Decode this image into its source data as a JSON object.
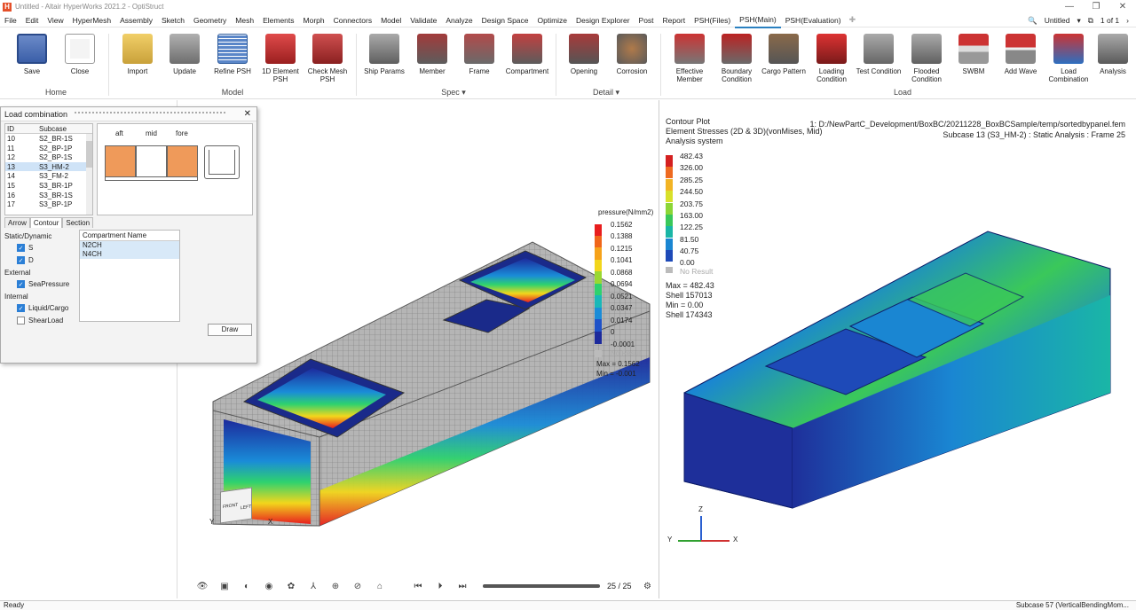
{
  "window": {
    "title": "Untitled - Altair HyperWorks 2021.2 - OptiStruct",
    "controls": [
      "—",
      "❐",
      "✕"
    ]
  },
  "menu": {
    "items": [
      "File",
      "Edit",
      "View",
      "HyperMesh",
      "Assembly",
      "Sketch",
      "Geometry",
      "Mesh",
      "Elements",
      "Morph",
      "Connectors",
      "Model",
      "Validate",
      "Analyze",
      "Design Space",
      "Optimize",
      "Design Explorer",
      "Post",
      "Report",
      "PSH(Files)",
      "PSH(Main)",
      "PSH(Evaluation)"
    ],
    "active": "PSH(Main)",
    "session": "Untitled",
    "page": "1 of 1"
  },
  "ribbon": {
    "buttons": [
      "Save",
      "Close",
      "Import",
      "Update",
      "Refine PSH",
      "1D Element PSH",
      "Check Mesh PSH",
      "Ship Params",
      "Member",
      "Frame",
      "Compartment",
      "Opening",
      "Corrosion",
      "Effective Member",
      "Boundary Condition",
      "Cargo Pattern",
      "Loading Condition",
      "Test Condition",
      "Flooded Condition",
      "SWBM",
      "Add Wave",
      "Load Combination",
      "Analysis"
    ],
    "groups": [
      "Home",
      "Model",
      "Spec",
      "Detail",
      "Load"
    ],
    "colors": {
      "icon_gray": "#8a8a8a",
      "icon_red": "#c0392b",
      "icon_green": "#3aa040",
      "icon_blue": "#3b6fc0"
    }
  },
  "load_dialog": {
    "title": "Load combination",
    "close": "✕",
    "table_headers": [
      "ID",
      "Subcase"
    ],
    "rows": [
      {
        "id": "10",
        "subcase": "S2_BR-1S"
      },
      {
        "id": "11",
        "subcase": "S2_BP-1P"
      },
      {
        "id": "12",
        "subcase": "S2_BP-1S"
      },
      {
        "id": "13",
        "subcase": "S3_HM-2"
      },
      {
        "id": "14",
        "subcase": "S3_FM-2"
      },
      {
        "id": "15",
        "subcase": "S3_BR-1P"
      },
      {
        "id": "16",
        "subcase": "S3_BR-1S"
      },
      {
        "id": "17",
        "subcase": "S3_BP-1P"
      }
    ],
    "selected_id": "13",
    "section_labels": [
      "aft",
      "mid",
      "fore"
    ],
    "tabs": [
      "Arrow",
      "Contour",
      "Section"
    ],
    "active_tab": "Contour",
    "groups": {
      "static_dynamic": "Static/Dynamic",
      "external": "External",
      "internal": "Internal"
    },
    "checks": {
      "s": "S",
      "d": "D",
      "sea": "SeaPressure",
      "liquid": "Liquid/Cargo",
      "shear": "ShearLoad"
    },
    "check_states": {
      "s": true,
      "d": true,
      "sea": true,
      "liquid": true,
      "shear": false
    },
    "compartment_header": "Compartment Name",
    "compartments": [
      "N2CH",
      "N4CH"
    ],
    "draw": "Draw",
    "section_fill": "#ef9a5a"
  },
  "pressure_legend": {
    "title": "pressure(N/mm2)",
    "values": [
      "0.1562",
      "0.1388",
      "0.1215",
      "0.1041",
      "0.0868",
      "0.0694",
      "0.0521",
      "0.0347",
      "0.0174",
      "0",
      "-0.0001"
    ],
    "colors": [
      "#e81e1e",
      "#f0661a",
      "#f6a21a",
      "#f2d61c",
      "#9ad832",
      "#2ed26e",
      "#18b8b8",
      "#1a8cd8",
      "#1f52c8",
      "#1c2a9c",
      "#bbbbbb"
    ],
    "no_result": "No Result",
    "max_line": "Max = 0.1562",
    "min_line": "Min = -0.001"
  },
  "stress_legend": {
    "header": [
      "Contour Plot",
      "Element Stresses (2D & 3D)(vonMises, Mid)",
      "Analysis system"
    ],
    "values": [
      "482.43",
      "326.00",
      "285.25",
      "244.50",
      "203.75",
      "163.00",
      "122.25",
      "81.50",
      "40.75",
      "0.00"
    ],
    "colors": [
      "#d42020",
      "#ee6a20",
      "#f2b424",
      "#d8e02a",
      "#8cd636",
      "#3ac85a",
      "#1ab6a6",
      "#1a86d2",
      "#1e4ab8"
    ],
    "no_result": "No Result",
    "stats": [
      "Max = 482.43",
      "Shell 157013",
      "Min = 0.00",
      "Shell 174343"
    ]
  },
  "right_info": {
    "path": "1: D:/NewPartC_Development/BoxBC/20211228_BoxBCSample/temp/sortedbypanel.fem",
    "subcase": "Subcase 13 (S3_HM-2) : Static Analysis : Frame 25"
  },
  "viewcube": {
    "front": "FRONT",
    "left": "LEFT",
    "axis_x": "X",
    "axis_y": "Y",
    "axis_z": "Z"
  },
  "animation": {
    "frame": "25 / 25"
  },
  "status": {
    "left": "Ready",
    "right": "Subcase 57 (VerticalBendingMom..."
  }
}
